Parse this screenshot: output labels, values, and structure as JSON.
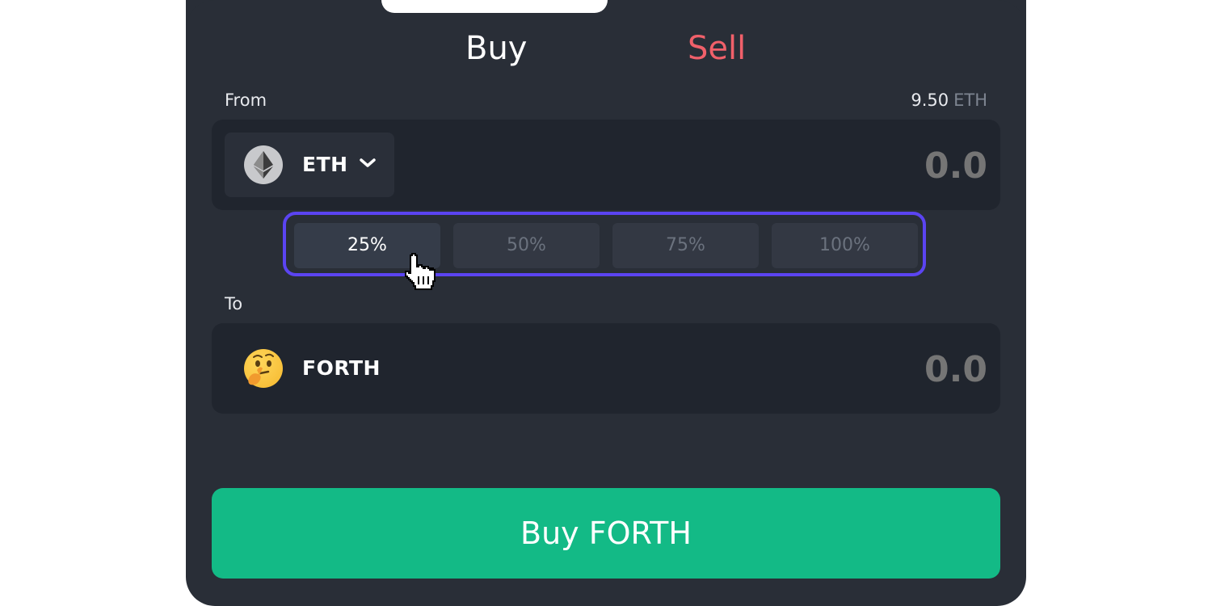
{
  "tabs": {
    "buy_label": "Buy",
    "sell_label": "Sell",
    "active": "Buy"
  },
  "from": {
    "label": "From",
    "balance_amount": "9.50",
    "balance_unit": "ETH",
    "token": "ETH",
    "token_icon": "ethereum-icon",
    "amount_placeholder": "0.0"
  },
  "percent_options": {
    "items": [
      "25%",
      "50%",
      "75%",
      "100%"
    ],
    "selected": "25%"
  },
  "to": {
    "label": "To",
    "token": "FORTH",
    "token_icon": "thinking-face-emoji-icon",
    "amount_placeholder": "0.0"
  },
  "cta": {
    "label": "Buy FORTH"
  },
  "colors": {
    "panel_bg": "#292e37",
    "box_bg": "#20252e",
    "sell_red": "#f0606a",
    "accent_purple": "#5b44f2",
    "cta_green": "#13ba86"
  }
}
